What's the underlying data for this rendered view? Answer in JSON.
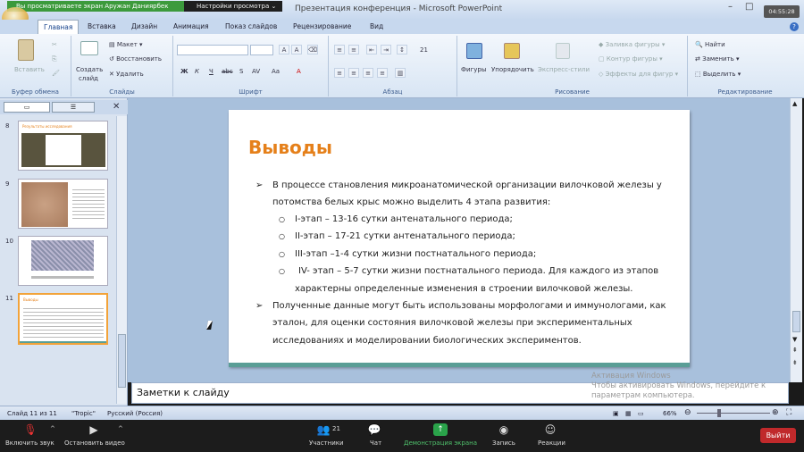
{
  "zoom_top": {
    "viewing": "Вы просматриваете экран Аружан Даниярбек",
    "view_settings": "Настройки просмотра",
    "clock": "04:55:28"
  },
  "window": {
    "title": "Презентация конференция - Microsoft PowerPoint"
  },
  "tabs": [
    "Главная",
    "Вставка",
    "Дизайн",
    "Анимация",
    "Показ слайдов",
    "Рецензирование",
    "Вид"
  ],
  "ribbon": {
    "clipboard": {
      "label": "Буфер обмена",
      "paste": "Вставить"
    },
    "slides": {
      "label": "Слайды",
      "create": "Создать",
      "slide": "слайд",
      "layout": "Макет",
      "reset": "Восстановить",
      "delete": "Удалить"
    },
    "font": {
      "label": "Шрифт",
      "bold": "Ж",
      "italic": "К",
      "underline": "Ч",
      "strike": "abc",
      "shadow": "S",
      "spacing": "AV",
      "case": "Aa",
      "color": "A"
    },
    "paragraph": {
      "label": "Абзац",
      "size": "21"
    },
    "drawing": {
      "label": "Рисование",
      "shapes": "Фигуры",
      "arrange": "Упорядочить",
      "quick_styles": "Экспресс-стили",
      "fill": "Заливка фигуры",
      "outline": "Контур фигуры",
      "effects": "Эффекты для фигур"
    },
    "editing": {
      "label": "Редактирование",
      "find": "Найти",
      "replace": "Заменить",
      "select": "Выделить"
    }
  },
  "thumbnails": [
    {
      "num": "8",
      "title": "Результаты исследования"
    },
    {
      "num": "9",
      "title": ""
    },
    {
      "num": "10",
      "title": ""
    },
    {
      "num": "11",
      "title": "Выводы"
    }
  ],
  "slide": {
    "title": "Выводы",
    "b1_l1": "В процессе становления микроанатомической организации вилочковой железы у",
    "b1_l2": "потомства белых крыс можно выделить 4 этапа развития:",
    "s1": "I-этап – 13-16 сутки антенатального периода;",
    "s2": "II-этап – 17-21 сутки антенатального периода;",
    "s3": "III-этап –1-4 сутки жизни постнатального периода;",
    "s4": "IV- этап – 5-7 сутки жизни постнатального периода. Для каждого из этапов",
    "s4_l2": "характерны определенные изменения в строении вилочковой железы.",
    "b2_l1": "Полученные данные могут быть использованы морфологами и иммунологами, как",
    "b2_l2": "эталон, для оценки состояния вилочковой железы при экспериментальных",
    "b2_l3": "исследованиях и моделировании биологических экспериментов."
  },
  "notes": {
    "placeholder": "Заметки к слайду"
  },
  "watermark": {
    "l1": "Активация Windows",
    "l2": "Чтобы активировать Windows, перейдите к",
    "l3": "параметрам компьютера."
  },
  "status": {
    "slide": "Слайд 11 из 11",
    "theme": "\"Tropic\"",
    "lang": "Русский (Россия)",
    "zoom": "66%"
  },
  "meeting": {
    "mute": "Включить звук",
    "video": "Остановить видео",
    "participants": "Участники",
    "participants_count": "21",
    "chat": "Чат",
    "share": "Демонстрация экрана",
    "record": "Запись",
    "reactions": "Реакции",
    "exit": "Выйти"
  }
}
